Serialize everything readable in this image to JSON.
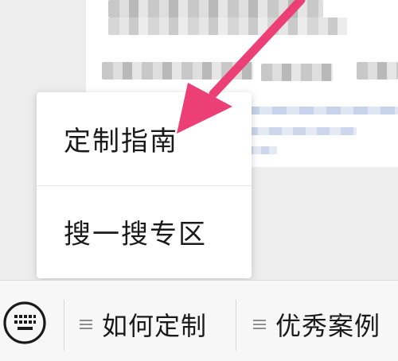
{
  "popup_menu": {
    "items": [
      {
        "label": "定制指南"
      },
      {
        "label": "搜一搜专区"
      }
    ]
  },
  "bottom_bar": {
    "keyboard_icon": "keyboard-icon",
    "tabs": [
      {
        "label": "如何定制",
        "icon": "hamburger-icon"
      },
      {
        "label": "优秀案例",
        "icon": "hamburger-icon"
      }
    ]
  },
  "colors": {
    "annotation_arrow": "#ec3f78",
    "popup_bg": "#ffffff",
    "bar_bg": "#f7f7f7",
    "chat_bg": "#ededed"
  }
}
